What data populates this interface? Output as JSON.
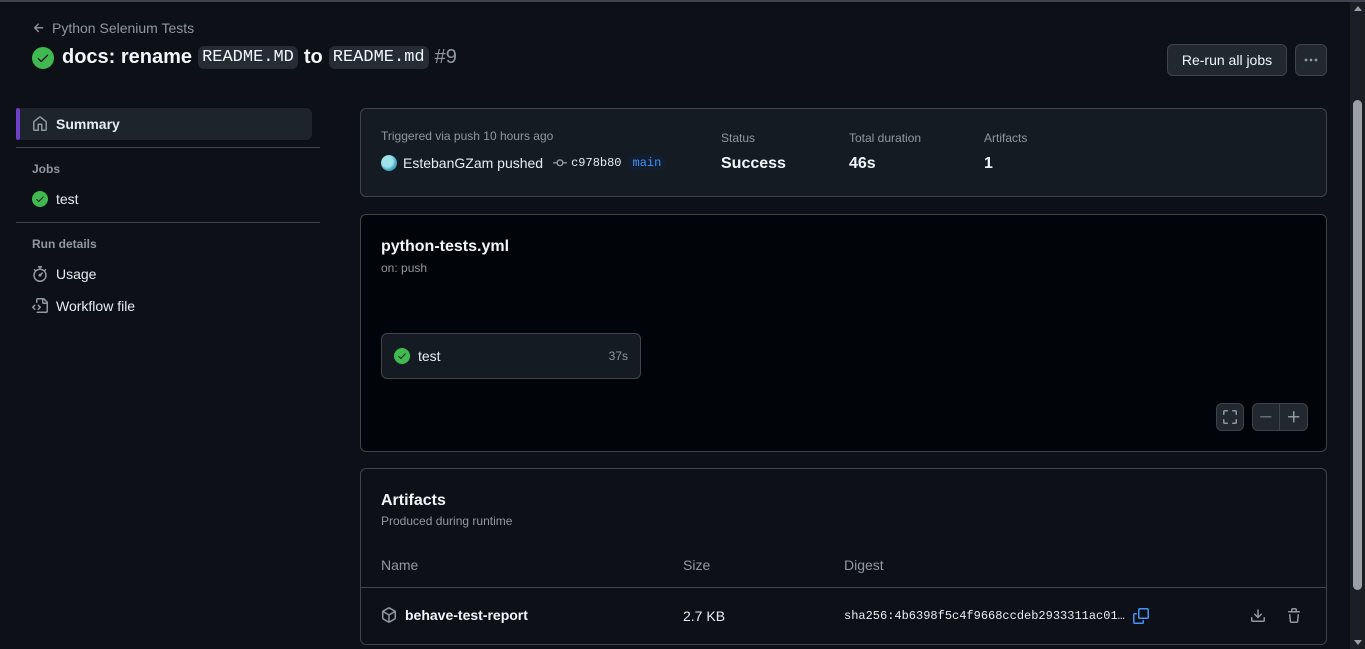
{
  "header": {
    "back_label": "Python Selenium Tests",
    "title_prefix": "docs: rename",
    "title_code_from": "README.MD",
    "title_mid": "to",
    "title_code_to": "README.md",
    "run_number": "#9",
    "rerun_label": "Re-run all jobs",
    "more_label": "···"
  },
  "sidebar": {
    "summary_label": "Summary",
    "jobs_heading": "Jobs",
    "jobs": [
      {
        "label": "test"
      }
    ],
    "run_details_heading": "Run details",
    "usage_label": "Usage",
    "workflow_file_label": "Workflow file"
  },
  "summary": {
    "trigger_text": "Triggered via push 10 hours ago",
    "actor": "EstebanGZam pushed",
    "commit": "c978b80",
    "branch": "main",
    "status_label": "Status",
    "status_value": "Success",
    "duration_label": "Total duration",
    "duration_value": "46s",
    "artifacts_label": "Artifacts",
    "artifacts_value": "1"
  },
  "workflow": {
    "file": "python-tests.yml",
    "on": "on: push",
    "job_name": "test",
    "job_duration": "37s"
  },
  "artifacts": {
    "title": "Artifacts",
    "subtitle": "Produced during runtime",
    "columns": [
      "Name",
      "Size",
      "Digest"
    ],
    "rows": [
      {
        "name": "behave-test-report",
        "size": "2.7 KB",
        "digest": "sha256:4b6398f5c4f9668ccdeb2933311ac01…"
      }
    ]
  },
  "colors": {
    "success": "#3fb950",
    "accent_bar": "#6e40c9",
    "link": "#4493f8"
  }
}
